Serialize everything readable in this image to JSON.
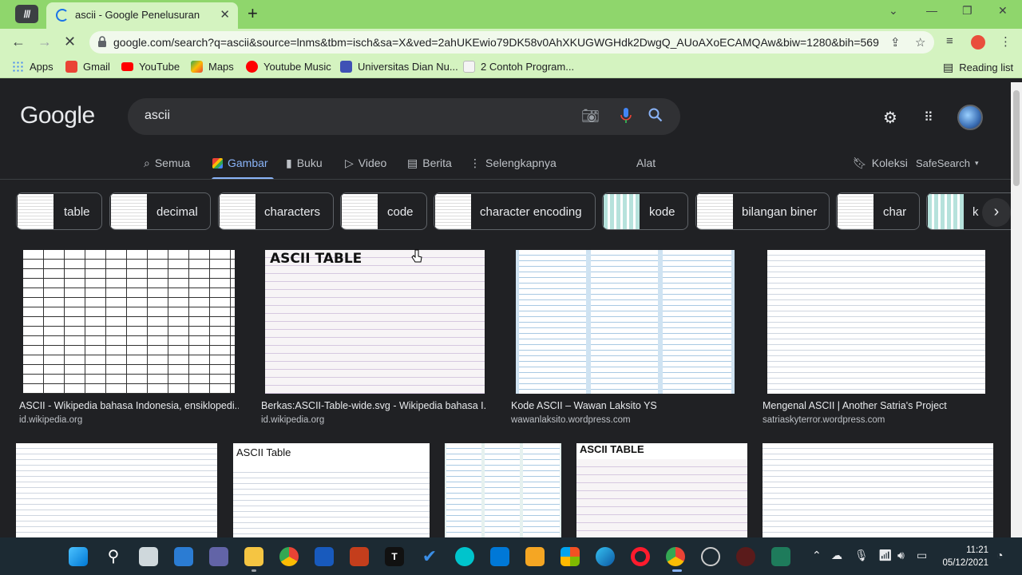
{
  "browser": {
    "tab_title": "ascii - Google Penelusuran",
    "url": "google.com/search?q=ascii&source=lnms&tbm=isch&sa=X&ved=2ahUKEwio79DK58v0AhXKUGWGHdk2DwgQ_AUoAXoECAMQAw&biw=1280&bih=569...",
    "bookmarks": [
      {
        "label": "Apps",
        "color": "#4285f4"
      },
      {
        "label": "Gmail",
        "color": "#ea4335"
      },
      {
        "label": "YouTube",
        "color": "#ff0000"
      },
      {
        "label": "Maps",
        "color": "#34a853"
      },
      {
        "label": "Youtube Music",
        "color": "#ff0000"
      },
      {
        "label": "Universitas Dian Nu...",
        "color": "#3f51b5"
      },
      {
        "label": "2 Contoh Program...",
        "color": "#f4f4f4"
      }
    ],
    "reading_list": "Reading list"
  },
  "google": {
    "logo": "Google",
    "query": "ascii",
    "tabs": [
      {
        "label": "Semua",
        "icon": "search-icon"
      },
      {
        "label": "Gambar",
        "icon": "image-icon"
      },
      {
        "label": "Buku",
        "icon": "book-icon"
      },
      {
        "label": "Video",
        "icon": "video-icon"
      },
      {
        "label": "Berita",
        "icon": "news-icon"
      },
      {
        "label": "Selengkapnya",
        "icon": "more-vert-icon"
      }
    ],
    "tools": "Alat",
    "collections": "Koleksi",
    "safesearch": "SafeSearch",
    "chips": [
      "table",
      "decimal",
      "characters",
      "code",
      "character encoding",
      "kode",
      "bilangan biner",
      "char",
      "k"
    ],
    "results": [
      {
        "title": "ASCII - Wikipedia bahasa Indonesia, ensiklopedi...",
        "source": "id.wikipedia.org"
      },
      {
        "title": "Berkas:ASCII-Table-wide.svg - Wikipedia bahasa I...",
        "source": "id.wikipedia.org",
        "heading": "ASCII TABLE"
      },
      {
        "title": "Kode ASCII – Wawan Laksito YS",
        "source": "wawanlaksito.wordpress.com"
      },
      {
        "title": "Mengenal ASCII | Another Satria's Project",
        "source": "satriaskyterror.wordpress.com"
      },
      {
        "title": "",
        "source": ""
      },
      {
        "title": "",
        "source": "",
        "heading": "ASCII Table"
      },
      {
        "title": "",
        "source": ""
      },
      {
        "title": "",
        "source": "",
        "heading": "ASCII TABLE"
      },
      {
        "title": "",
        "source": ""
      }
    ],
    "accent": "#8ab4f8"
  },
  "taskbar": {
    "time": "11:21",
    "date": "05/12/2021"
  }
}
